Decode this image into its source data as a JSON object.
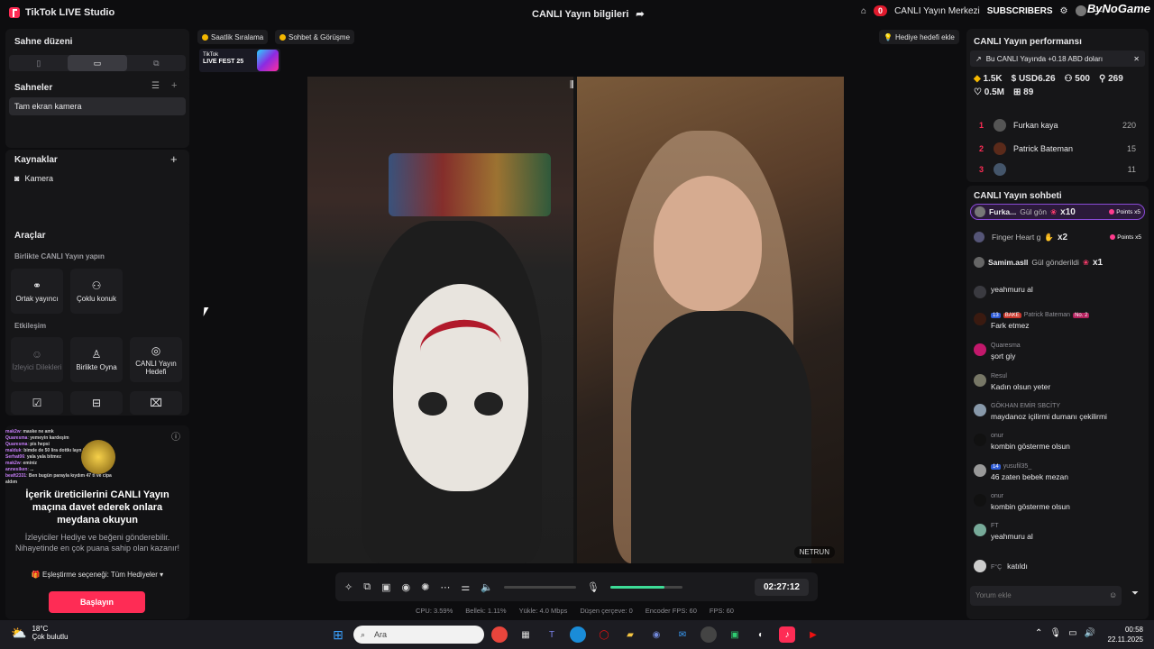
{
  "titlebar": {
    "app_name": "TikTok LIVE Studio",
    "stream_info": "CANLI Yayın bilgileri",
    "notif_count": "0",
    "center_label": "CANLI Yayın Merkezi",
    "subscribers_label": "SUBSCRIBERS",
    "watermark": "ByNoGame"
  },
  "left": {
    "scene_layout_title": "Sahne düzeni",
    "scenes_title": "Sahneler",
    "scene_item": "Tam ekran kamera",
    "sources_title": "Kaynaklar",
    "source_item": "Kamera",
    "tools_title": "Araçlar",
    "collab_title": "Birlikte CANLI Yayın yapın",
    "tool_cohost": "Ortak yayıncı",
    "tool_multiguest": "Çoklu konuk",
    "interaction_title": "Etkileşim",
    "tool_viewer_requests": "İzleyici Dilekleri",
    "tool_play_together": "Birlikte Oyna",
    "tool_live_goal": "CANLI Yayın Hedefi"
  },
  "invite": {
    "mini_chat": [
      {
        "user": "mak2w",
        "text": "maske ne amk"
      },
      {
        "user": "Quaresma",
        "text": "yemeyin kardeşim"
      },
      {
        "user": "Quaresma",
        "text": "pis hepsi"
      },
      {
        "user": "malduk",
        "text": "bimde de 50 lira dottkı layn falan"
      },
      {
        "user": "Serhat06",
        "text": "yala yala bitmez"
      },
      {
        "user": "mak2w",
        "text": "eminiz"
      },
      {
        "user": "annesiken",
        "text": "..."
      },
      {
        "user": "beaft2331",
        "text": "Ben bugün parayla kıydım 47 tl ve cipa aldım"
      }
    ],
    "title": "İçerik üreticilerini CANLI Yayın maçına davet ederek onlara meydana okuyun",
    "text": "İzleyiciler Hediye ve beğeni gönderebilir. Nihayetinde en çok puana sahip olan kazanır!",
    "select_label": "Eşleştirme seçeneği: Tüm Hediyeler",
    "start_button": "Başlayın"
  },
  "center": {
    "pill_ranking": "Saatlik Sıralama",
    "pill_chat": "Sohbet & Görüşme",
    "gift_goal": "Hediye hedefi ekle",
    "fest_line1": "TikTok",
    "fest_line2": "LIVE FEST 25",
    "netrun": "NETRUN",
    "timer": "02:27:12",
    "mic_level": 0.75
  },
  "stats": {
    "cpu": "CPU: 3.59%",
    "memory": "Bellek: 1.11%",
    "upload": "Yükle: 4.0 Mbps",
    "dropped": "Düşen çerçeve: 0",
    "encoder_fps": "Encoder FPS: 60",
    "fps": "FPS: 60"
  },
  "right": {
    "perf_title": "CANLI Yayın performansı",
    "banner": "Bu CANLI Yayında +0.18 ABD doları",
    "m_diamonds": "1.5K",
    "m_usd": "USD6.26",
    "m_viewers": "500",
    "m_followers": "269",
    "m_likes": "0.5M",
    "m_gifts": "89",
    "ranking": [
      {
        "n": "1",
        "name": "Furkan kaya",
        "val": "220"
      },
      {
        "n": "2",
        "name": "Patrick Bateman",
        "val": "15"
      },
      {
        "n": "3",
        "name": "",
        "val": "11"
      }
    ],
    "chat_title": "CANLI Yayın sohbeti",
    "gifts": [
      {
        "user": "Furka...",
        "text": "Gül gön",
        "mult": "x10",
        "pts": "Points x5"
      },
      {
        "user": "",
        "text": "Finger Heart g",
        "mult": "x2",
        "pts": "Points x5"
      },
      {
        "user": "Samim.asll",
        "text": "Gül gönderildi",
        "mult": "x1",
        "pts": ""
      }
    ],
    "messages": [
      {
        "user": "",
        "text": "yeahmuru al"
      },
      {
        "user": "Patrick Bateman",
        "text": "Fark etmez"
      },
      {
        "user": "Quaresma",
        "text": "şort giy"
      },
      {
        "user": "Resul",
        "text": "Kadın olsun yeter"
      },
      {
        "user": "GÖKHAN EMİR SBCİTY",
        "text": "maydanoz içilirmi dumanı çekilirmi"
      },
      {
        "user": "onur",
        "text": "kombin gösterme olsun"
      },
      {
        "user": "yusufil35_",
        "text": "46 zaten bebek mezan"
      },
      {
        "user": "onur",
        "text": "kombin gösterme olsun"
      },
      {
        "user": "FT",
        "text": "yeahmuru al"
      },
      {
        "user": "F°Ç",
        "text": "katıldı"
      }
    ],
    "chat_placeholder": "Yorum ekle"
  },
  "taskbar": {
    "temp": "18°C",
    "weather": "Çok bulutlu",
    "search": "Ara",
    "time": "00:58",
    "date": "22.11.2025"
  }
}
